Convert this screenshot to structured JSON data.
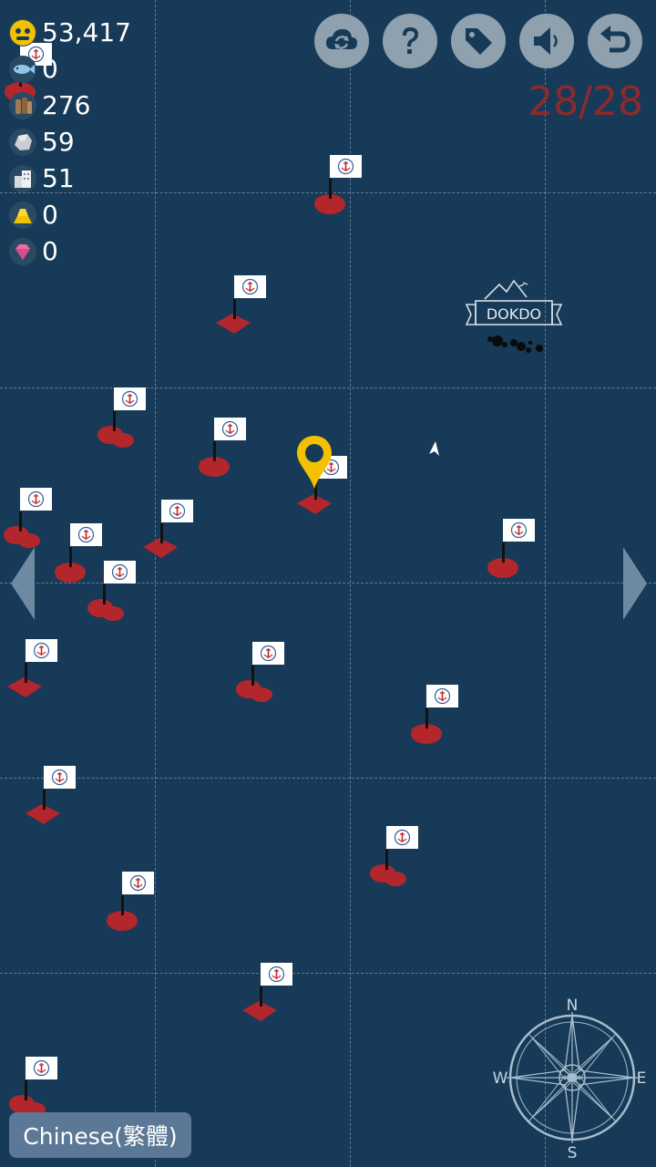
{
  "resources": [
    {
      "name": "gold",
      "icon": "gold-coin-icon",
      "value": "53,417"
    },
    {
      "name": "fish",
      "icon": "fish-icon",
      "value": "0"
    },
    {
      "name": "wood",
      "icon": "wood-icon",
      "value": "276"
    },
    {
      "name": "stone",
      "icon": "stone-icon",
      "value": "59"
    },
    {
      "name": "building",
      "icon": "building-icon",
      "value": "51"
    },
    {
      "name": "gold-bar",
      "icon": "gold-bar-icon",
      "value": "0"
    },
    {
      "name": "gem",
      "icon": "gem-icon",
      "value": "0"
    }
  ],
  "toolbar": [
    "cloud-sync-icon",
    "help-icon",
    "tag-icon",
    "sound-icon",
    "back-icon"
  ],
  "counter": "28/28",
  "landmark": {
    "label": "DOKDO"
  },
  "compass": {
    "n": "N",
    "e": "E",
    "s": "S",
    "w": "W"
  },
  "language_button": "Chinese(繁體)",
  "colors": {
    "sea": "#163a57",
    "island": "#b3262b",
    "counter": "#8c2a2e",
    "marker": "#f2c200",
    "button": "#8fa0ae"
  }
}
